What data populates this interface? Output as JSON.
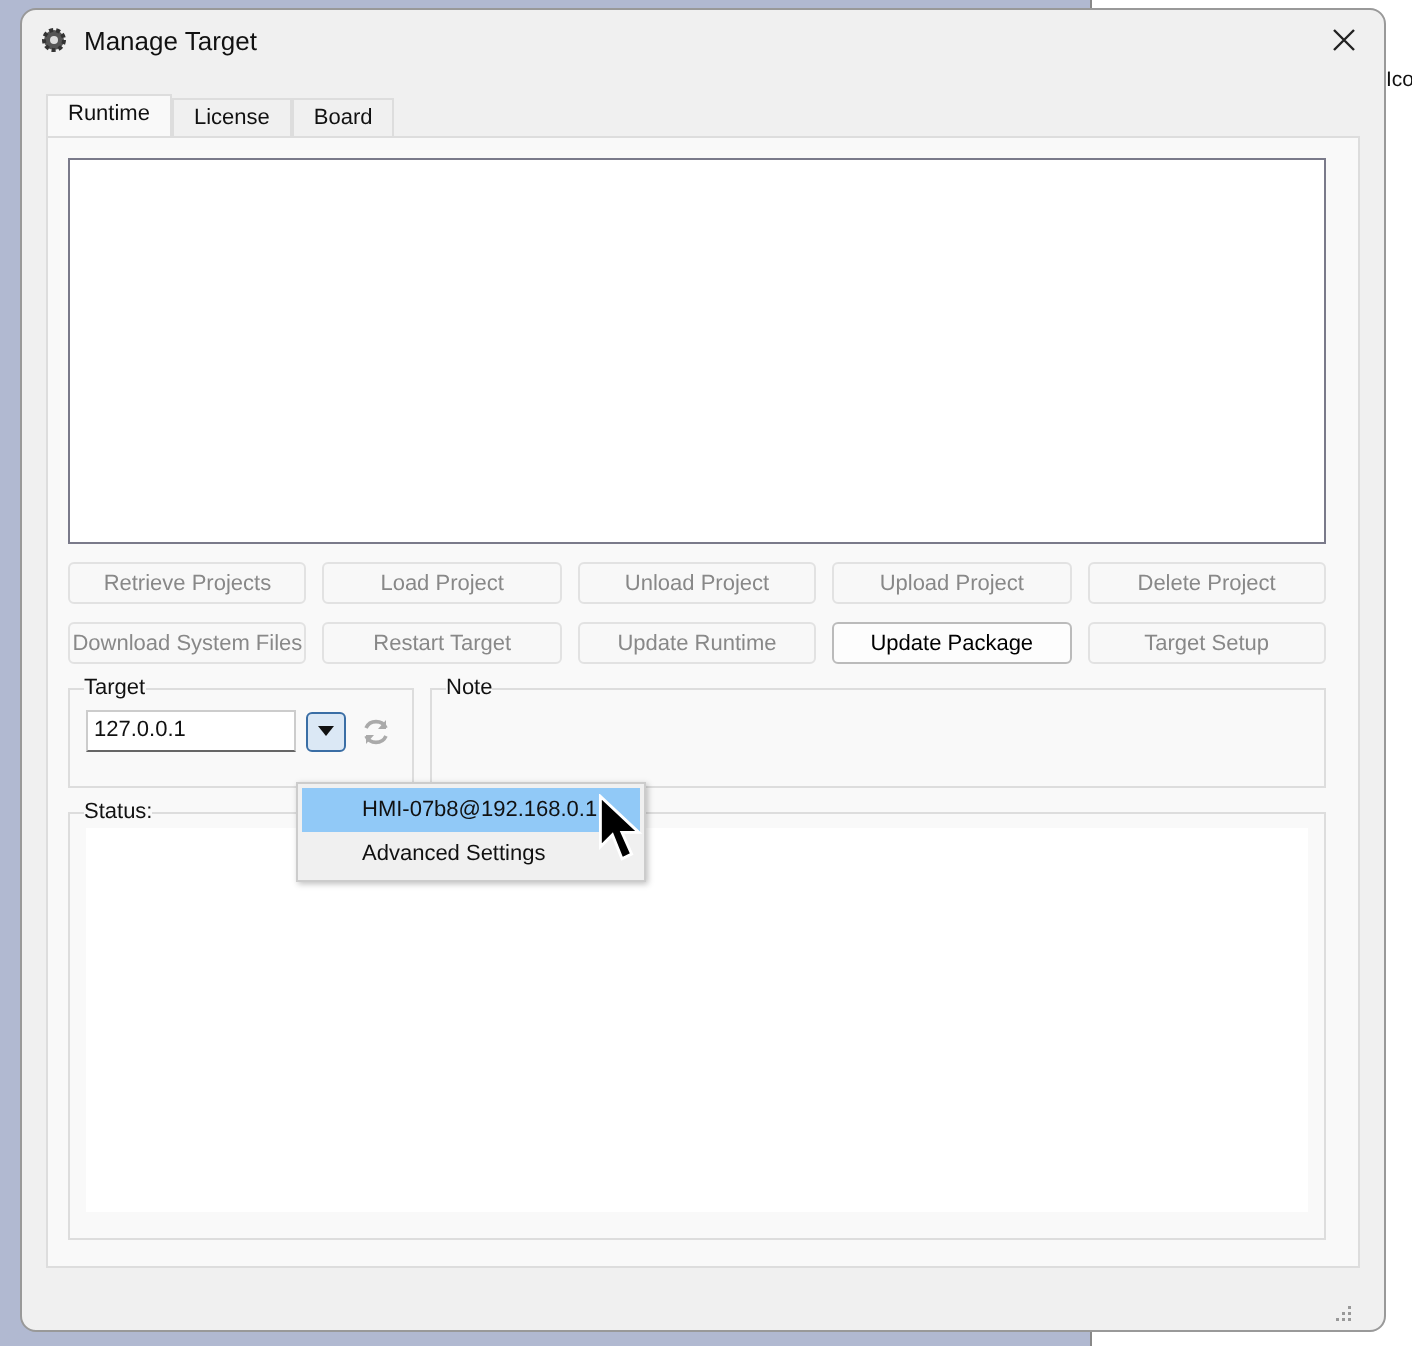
{
  "background_text": "Ico",
  "window": {
    "title": "Manage Target"
  },
  "tabs": [
    {
      "label": "Runtime",
      "selected": true
    },
    {
      "label": "License",
      "selected": false
    },
    {
      "label": "Board",
      "selected": false
    }
  ],
  "buttons": [
    {
      "label": "Retrieve Projects",
      "disabled": true
    },
    {
      "label": "Load Project",
      "disabled": true
    },
    {
      "label": "Unload Project",
      "disabled": true
    },
    {
      "label": "Upload Project",
      "disabled": true
    },
    {
      "label": "Delete Project",
      "disabled": true
    },
    {
      "label": "Download System Files",
      "disabled": true
    },
    {
      "label": "Restart Target",
      "disabled": true
    },
    {
      "label": "Update Runtime",
      "disabled": true
    },
    {
      "label": "Update Package",
      "disabled": false
    },
    {
      "label": "Target Setup",
      "disabled": true
    }
  ],
  "target": {
    "label": "Target",
    "value": "127.0.0.1",
    "dropdown_open": true,
    "options": [
      {
        "label": "HMI-07b8@192.168.0.1",
        "selected": true
      },
      {
        "label": "Advanced Settings",
        "selected": false
      }
    ]
  },
  "note": {
    "label": "Note"
  },
  "status": {
    "label": "Status:"
  }
}
